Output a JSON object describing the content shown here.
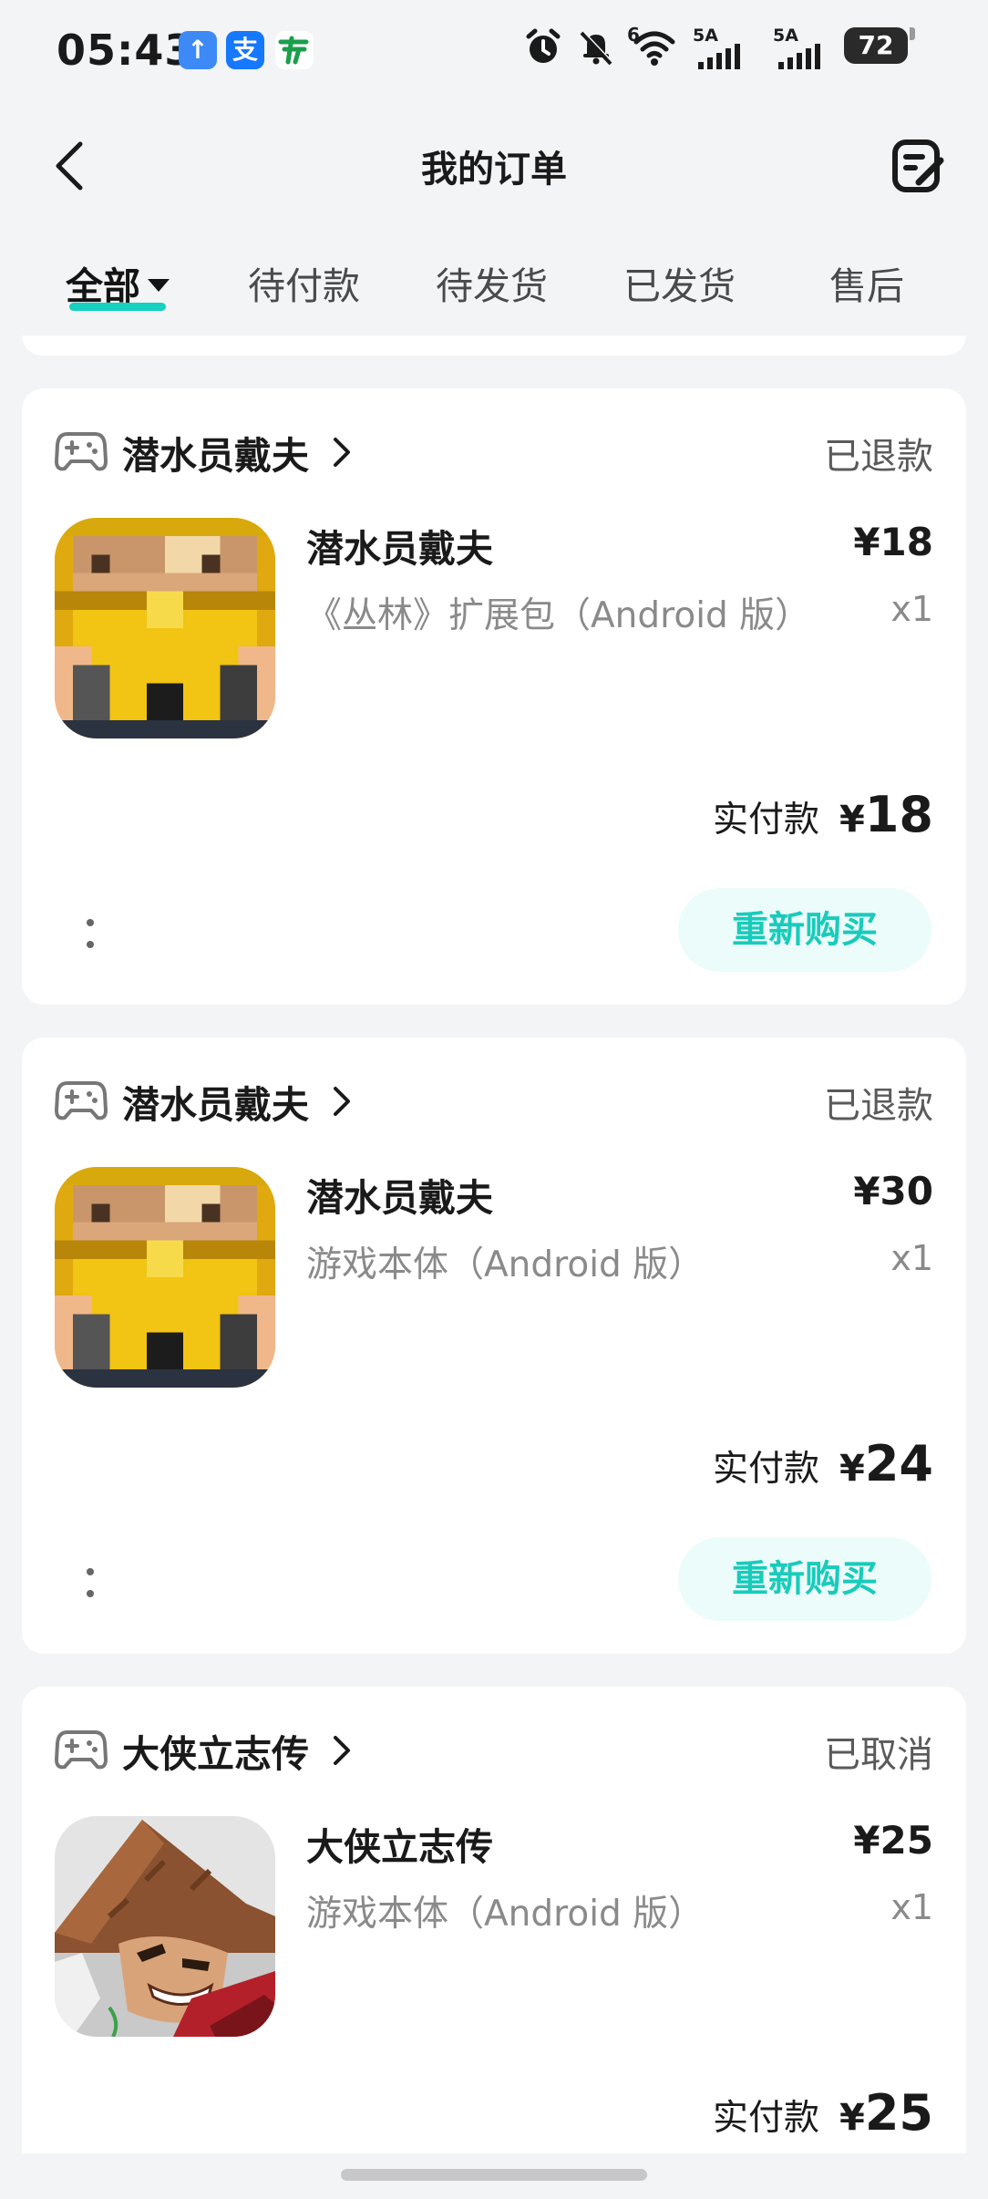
{
  "status_bar": {
    "time": "05:43",
    "app_icons": [
      "↑",
      "支",
      "邮"
    ],
    "network_1": "5A",
    "network_2": "5A",
    "wifi_label": "6",
    "battery": "72"
  },
  "header": {
    "title": "我的订单",
    "back_icon": "chevron-left-icon",
    "edit_icon": "edit-order-icon"
  },
  "tabs": [
    {
      "label": "全部",
      "active": true
    },
    {
      "label": "待付款",
      "active": false
    },
    {
      "label": "待发货",
      "active": false
    },
    {
      "label": "已发货",
      "active": false
    },
    {
      "label": "售后",
      "active": false
    }
  ],
  "orders": [
    {
      "store": "潜水员戴夫",
      "status": "已退款",
      "product_name": "潜水员戴夫",
      "variant": "《丛林》扩展包（Android 版）",
      "price": "¥18",
      "qty": "x1",
      "paid_label": "实付款",
      "paid_yen": "¥",
      "paid_amount": "18",
      "action": "重新购买"
    },
    {
      "store": "潜水员戴夫",
      "status": "已退款",
      "product_name": "潜水员戴夫",
      "variant": "游戏本体（Android 版）",
      "price": "¥30",
      "qty": "x1",
      "paid_label": "实付款",
      "paid_yen": "¥",
      "paid_amount": "24",
      "action": "重新购买"
    },
    {
      "store": "大侠立志传",
      "status": "已取消",
      "product_name": "大侠立志传",
      "variant": "游戏本体（Android 版）",
      "price": "¥25",
      "qty": "x1",
      "paid_label": "实付款",
      "paid_yen": "¥",
      "paid_amount": "25"
    }
  ],
  "colors": {
    "accent": "#16d0c0",
    "button_text": "#19cbbb",
    "button_bg": "#ecfcfa",
    "page_bg": "#f3f4f6"
  }
}
